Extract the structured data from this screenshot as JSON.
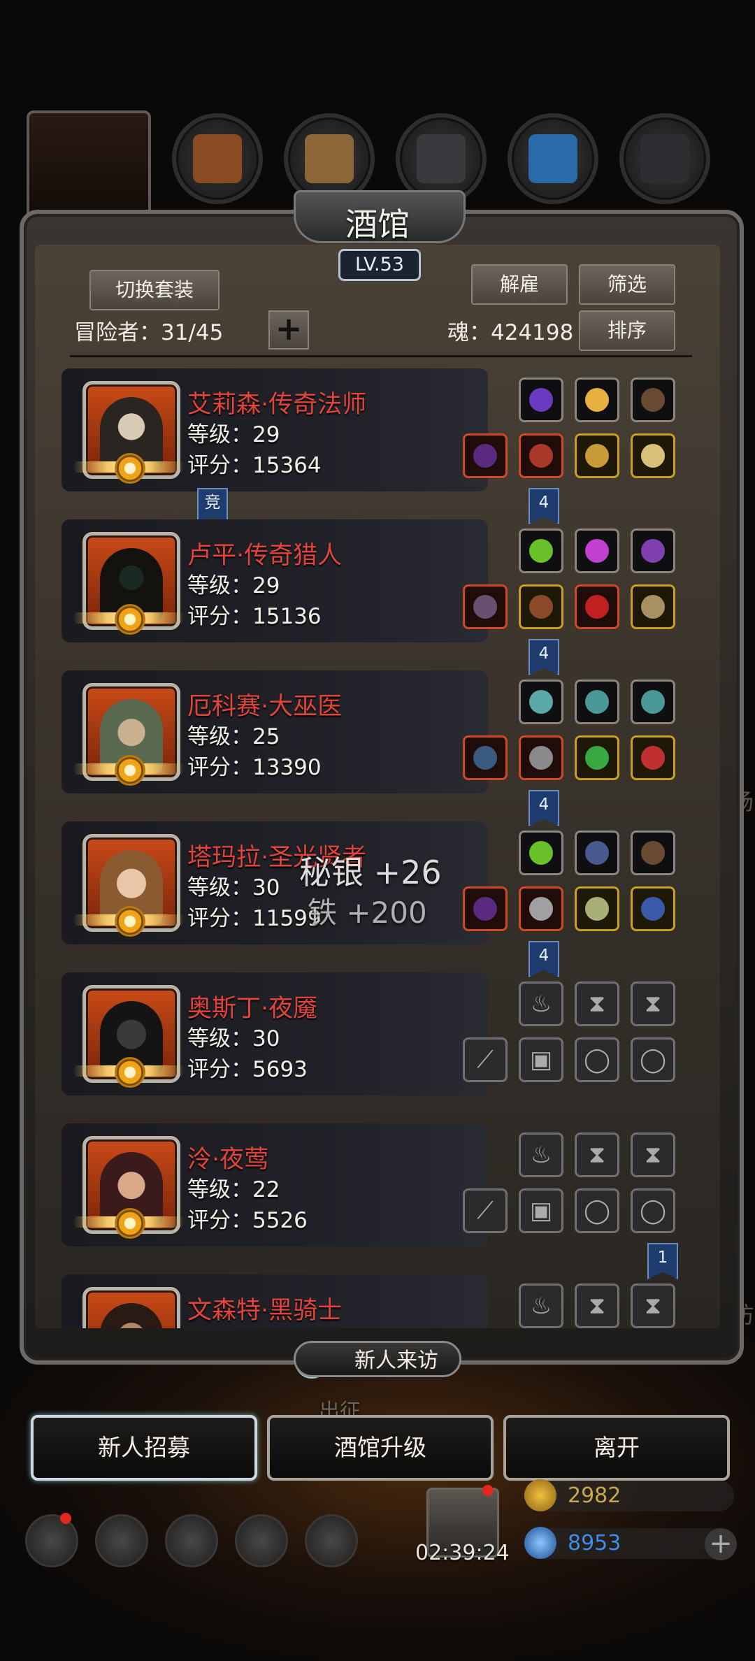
{
  "panel": {
    "title": "酒馆",
    "level": "LV.53",
    "switch_outfit_label": "切换套装",
    "dismiss_label": "解雇",
    "filter_label": "筛选",
    "sort_label": "排序",
    "adventurer_count": "冒险者：31/45",
    "add_label": "+",
    "soul": "魂：424198"
  },
  "heroes": [
    {
      "name": "艾莉森·传奇法师",
      "level": "等级：29",
      "score": "评分：15364",
      "portrait": "mage-portrait",
      "equip_top": [
        "gem-purple",
        "lantern",
        "pouch"
      ],
      "equip_bottom": [
        "staff",
        "lantern-red",
        "ring",
        "pendant"
      ],
      "badge_left": "竞",
      "badge_right": "4"
    },
    {
      "name": "卢平·传奇猎人",
      "level": "等级：29",
      "score": "评分：15136",
      "portrait": "hunter-portrait",
      "equip_top": [
        "potion-green",
        "gem-pink",
        "lantern"
      ],
      "equip_bottom": [
        "crossbow",
        "armor",
        "eye",
        "ring"
      ],
      "badge_right": "4"
    },
    {
      "name": "厄科赛·大巫医",
      "level": "等级：25",
      "score": "评分：13390",
      "portrait": "witchdoctor-portrait",
      "equip_top": [
        "stone",
        "stone",
        "stone"
      ],
      "equip_bottom": [
        "wand",
        "armor",
        "frog",
        "amulet"
      ],
      "badge_right": "4"
    },
    {
      "name": "塔玛拉·圣光贤者",
      "level": "等级：30",
      "score": "评分：11599",
      "portrait": "sage-portrait",
      "equip_top": [
        "potion-green",
        "triangle",
        "pouch"
      ],
      "equip_bottom": [
        "staff",
        "armor",
        "ring",
        "pendant"
      ],
      "badge_right": "4"
    },
    {
      "name": "奥斯丁·夜魇",
      "level": "等级：30",
      "score": "评分：5693",
      "portrait": "nightmare-portrait",
      "equip_top": [
        "flame",
        "hourglass",
        "hourglass"
      ],
      "equip_bottom": [
        "blade",
        "armor",
        "ring",
        "ring"
      ]
    },
    {
      "name": "泠·夜莺",
      "level": "等级：22",
      "score": "评分：5526",
      "portrait": "nightingale-portrait",
      "equip_top": [
        "flame",
        "hourglass",
        "hourglass"
      ],
      "equip_bottom": [
        "blade",
        "armor",
        "ring",
        "ring"
      ],
      "badge_right": "1"
    },
    {
      "name": "文森特·黑骑士",
      "level": "",
      "score": "",
      "portrait": "knight-portrait",
      "equip_top": [
        "flame",
        "hourglass",
        "hourglass"
      ],
      "equip_bottom": []
    }
  ],
  "popup": {
    "line1": "秘银 +26",
    "line2": "铁 +200"
  },
  "visitor_label": "新人来访",
  "buttons": {
    "recruit": "新人招募",
    "upgrade": "酒馆升级",
    "leave": "离开"
  },
  "behind_label": "出征",
  "timer": "02:39:24",
  "currencies": {
    "gold": "2982",
    "gems": "8953"
  },
  "side_text": {
    "right_1": "场",
    "right_2": "坊"
  },
  "colors": {
    "hero_name": "#e0443a",
    "gold": "#c8a84a",
    "gems": "#3e8ee8"
  }
}
